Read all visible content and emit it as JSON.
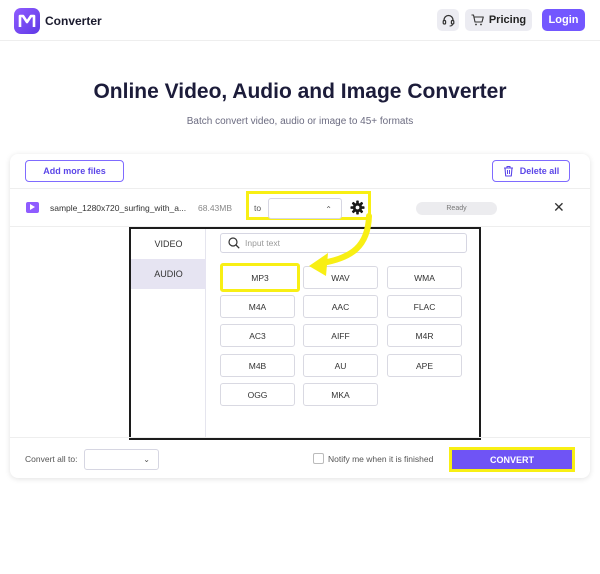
{
  "app": {
    "name": "Converter",
    "brand_color": "#7357ff"
  },
  "header": {
    "pricing_label": "Pricing",
    "login_label": "Login"
  },
  "hero": {
    "title": "Online Video, Audio and Image Converter",
    "subtitle": "Batch convert video, audio or image to 45+ formats"
  },
  "toolbar": {
    "add_files_label": "Add more files",
    "delete_all_label": "Delete all"
  },
  "file": {
    "name": "sample_1280x720_surfing_with_a...",
    "size": "68.43MB",
    "to_label": "to",
    "target_format": "",
    "status": "Ready"
  },
  "dropdown": {
    "categories": [
      {
        "label": "VIDEO",
        "active": false
      },
      {
        "label": "AUDIO",
        "active": true
      }
    ],
    "search_placeholder": "Input text",
    "formats": [
      "MP3",
      "WAV",
      "WMA",
      "M4A",
      "AAC",
      "FLAC",
      "AC3",
      "AIFF",
      "M4R",
      "M4B",
      "AU",
      "APE",
      "OGG",
      "MKA"
    ],
    "highlighted_format": "MP3"
  },
  "bottom": {
    "convert_all_label": "Convert all to:",
    "convert_all_value": "",
    "notify_label": "Notify me when it is finished",
    "notify_checked": false,
    "convert_label": "CONVERT"
  },
  "annotation": {
    "highlight_color": "#f8ef14"
  }
}
